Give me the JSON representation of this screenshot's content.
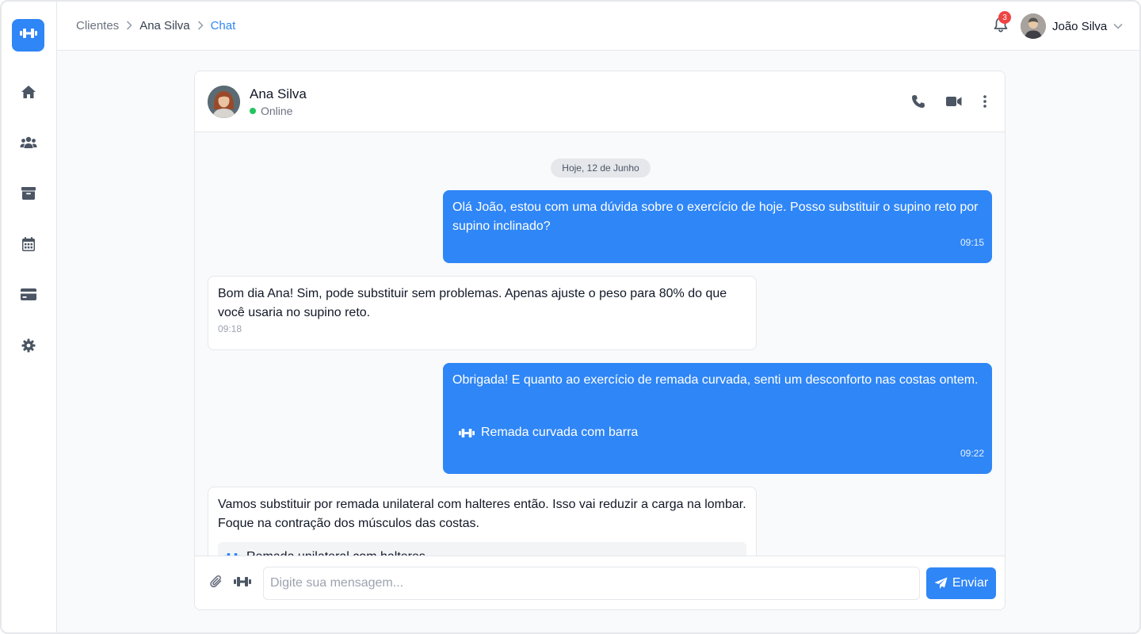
{
  "sidebar": {
    "logo_icon": "dumbbell-icon",
    "items": [
      {
        "name": "home",
        "icon": "home-icon"
      },
      {
        "name": "clients",
        "icon": "users-icon"
      },
      {
        "name": "archive",
        "icon": "archive-icon"
      },
      {
        "name": "calendar",
        "icon": "calendar-icon"
      },
      {
        "name": "payments",
        "icon": "credit-card-icon"
      },
      {
        "name": "settings",
        "icon": "gear-icon"
      }
    ]
  },
  "header": {
    "breadcrumb": [
      "Clientes",
      "Ana Silva",
      "Chat"
    ],
    "notifications_count": "3",
    "user_name": "João Silva"
  },
  "chat": {
    "contact_name": "Ana Silva",
    "contact_status": "Online",
    "date_label": "Hoje, 12 de Junho",
    "messages": [
      {
        "direction": "out",
        "text": "Olá João, estou com uma dúvida sobre o exercício de hoje. Posso substituir o supino reto por supino inclinado?",
        "time": "09:15"
      },
      {
        "direction": "in",
        "text": "Bom dia Ana! Sim, pode substituir sem problemas. Apenas ajuste o peso para 80% do que você usaria no supino reto.",
        "time": "09:18"
      },
      {
        "direction": "out",
        "text": "Obrigada! E quanto ao exercício de remada curvada, senti um desconforto nas costas ontem.",
        "exercise": "Remada curvada com barra",
        "time": "09:22"
      },
      {
        "direction": "in",
        "text": "Vamos substituir por remada unilateral com halteres então. Isso vai reduzir a carga na lombar. Foque na contração dos músculos das costas.",
        "exercise": "Remada unilateral com halteres"
      }
    ]
  },
  "composer": {
    "placeholder": "Digite sua mensagem...",
    "send_label": "Enviar"
  },
  "colors": {
    "accent": "#2f86f6",
    "online": "#22c55e",
    "badge": "#ef4444"
  }
}
